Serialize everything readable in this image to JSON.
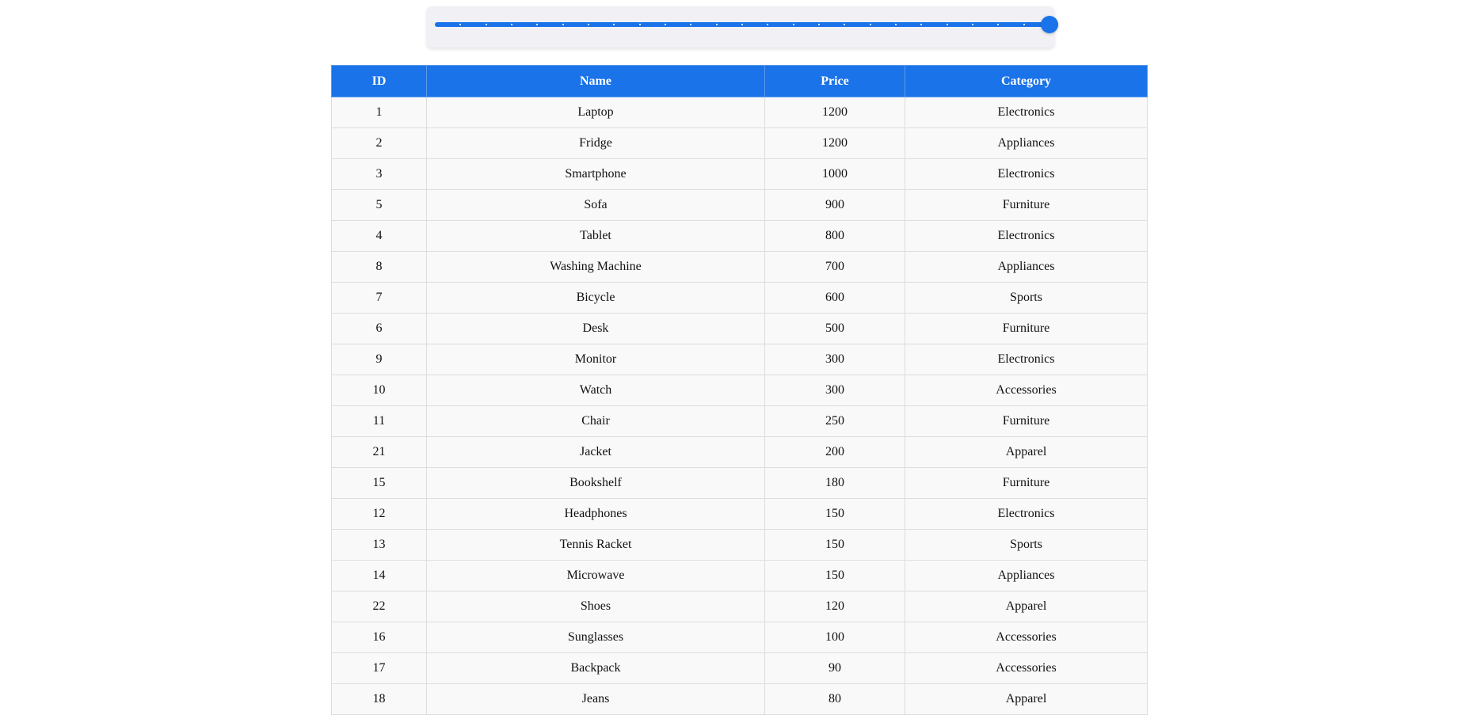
{
  "slider": {
    "min": 0,
    "max": 24,
    "value": 24,
    "tick_count": 24,
    "accent_color": "#1a73e8"
  },
  "table": {
    "header_color": "#1a73e8",
    "columns": [
      "ID",
      "Name",
      "Price",
      "Category"
    ],
    "rows": [
      [
        "1",
        "Laptop",
        "1200",
        "Electronics"
      ],
      [
        "2",
        "Fridge",
        "1200",
        "Appliances"
      ],
      [
        "3",
        "Smartphone",
        "1000",
        "Electronics"
      ],
      [
        "5",
        "Sofa",
        "900",
        "Furniture"
      ],
      [
        "4",
        "Tablet",
        "800",
        "Electronics"
      ],
      [
        "8",
        "Washing Machine",
        "700",
        "Appliances"
      ],
      [
        "7",
        "Bicycle",
        "600",
        "Sports"
      ],
      [
        "6",
        "Desk",
        "500",
        "Furniture"
      ],
      [
        "9",
        "Monitor",
        "300",
        "Electronics"
      ],
      [
        "10",
        "Watch",
        "300",
        "Accessories"
      ],
      [
        "11",
        "Chair",
        "250",
        "Furniture"
      ],
      [
        "21",
        "Jacket",
        "200",
        "Apparel"
      ],
      [
        "15",
        "Bookshelf",
        "180",
        "Furniture"
      ],
      [
        "12",
        "Headphones",
        "150",
        "Electronics"
      ],
      [
        "13",
        "Tennis Racket",
        "150",
        "Sports"
      ],
      [
        "14",
        "Microwave",
        "150",
        "Appliances"
      ],
      [
        "22",
        "Shoes",
        "120",
        "Apparel"
      ],
      [
        "16",
        "Sunglasses",
        "100",
        "Accessories"
      ],
      [
        "17",
        "Backpack",
        "90",
        "Accessories"
      ],
      [
        "18",
        "Jeans",
        "80",
        "Apparel"
      ]
    ]
  }
}
